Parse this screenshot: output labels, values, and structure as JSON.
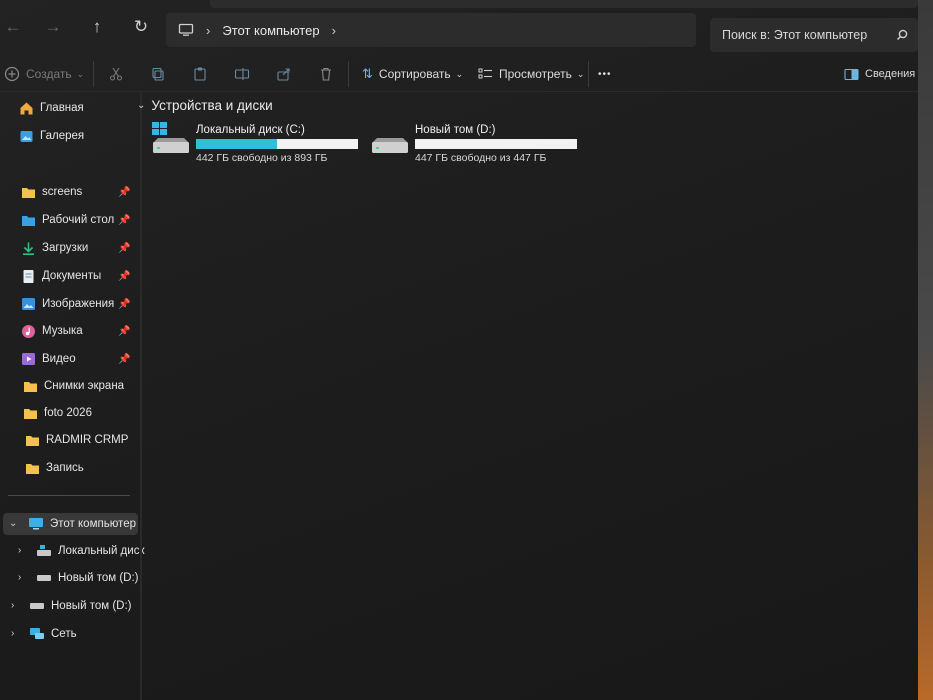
{
  "address": {
    "breadcrumb": "Этот компьютер",
    "search_placeholder": "Поиск в: Этот компьютер"
  },
  "toolbar": {
    "create_label": "Создать",
    "sort_label": "Сортировать",
    "view_label": "Просмотреть",
    "more_label": "•••",
    "details_label": "Сведения"
  },
  "sidebar": {
    "quick": [
      {
        "label": "Главная",
        "icon": "home-icon"
      },
      {
        "label": "Галерея",
        "icon": "gallery-icon"
      }
    ],
    "pinned": [
      {
        "label": "screens",
        "icon": "folder-icon",
        "pinned": true
      },
      {
        "label": "Рабочий стол",
        "icon": "desktop-folder-icon",
        "pinned": true
      },
      {
        "label": "Загрузки",
        "icon": "download-icon",
        "pinned": true
      },
      {
        "label": "Документы",
        "icon": "documents-icon",
        "pinned": true
      },
      {
        "label": "Изображения",
        "icon": "pictures-icon",
        "pinned": true
      },
      {
        "label": "Музыка",
        "icon": "music-icon",
        "pinned": true
      },
      {
        "label": "Видео",
        "icon": "video-icon",
        "pinned": true
      },
      {
        "label": "Снимки экрана",
        "icon": "folder-icon",
        "pinned": false
      },
      {
        "label": "foto 2026",
        "icon": "folder-icon",
        "pinned": false
      },
      {
        "label": "RADMIR CRMP",
        "icon": "folder-icon",
        "pinned": false
      },
      {
        "label": "Запись",
        "icon": "folder-icon",
        "pinned": false
      }
    ],
    "tree": [
      {
        "label": "Этот компьютер",
        "icon": "computer-icon"
      },
      {
        "label": "Локальный диск",
        "icon": "drive-icon"
      },
      {
        "label": "Новый том (D:)",
        "icon": "drive-icon"
      },
      {
        "label": "Новый том (D:)",
        "icon": "drive-icon"
      },
      {
        "label": "Сеть",
        "icon": "network-icon"
      }
    ]
  },
  "content": {
    "group_title": "Устройства и диски",
    "drives": [
      {
        "name": "Локальный диск (C:)",
        "free_text": "442 ГБ свободно из 893 ГБ",
        "used_fraction": 0.5,
        "bar_color": "#2fbfd8"
      },
      {
        "name": "Новый том (D:)",
        "free_text": "447 ГБ свободно из 447 ГБ",
        "used_fraction": 0.0,
        "bar_color": "#2fbfd8"
      }
    ]
  },
  "colors": {
    "background": "#1d1d1d",
    "accent": "#2fbfd8",
    "folder": "#f2c14e"
  }
}
